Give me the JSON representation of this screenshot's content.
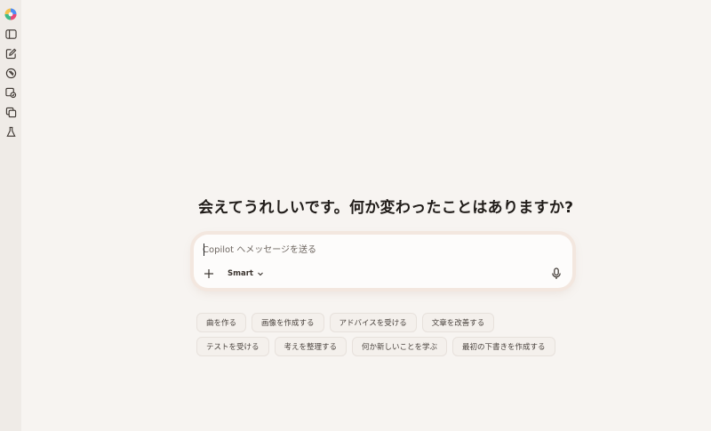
{
  "sidebar": {
    "items": [
      {
        "icon": "copilot-logo-icon"
      },
      {
        "icon": "sidebar-toggle-icon"
      },
      {
        "icon": "new-chat-icon"
      },
      {
        "icon": "discover-icon"
      },
      {
        "icon": "image-gallery-icon"
      },
      {
        "icon": "pages-icon"
      },
      {
        "icon": "labs-flask-icon"
      }
    ]
  },
  "main": {
    "greeting": "会えてうれしいです。何か変わったことはありますか?"
  },
  "composer": {
    "placeholder": "Copilot へメッセージを送る",
    "mode_label": "Smart"
  },
  "suggestions": {
    "chips": [
      "曲を作る",
      "画像を作成する",
      "アドバイスを受ける",
      "文章を改善する",
      "テストを受ける",
      "考えを整理する",
      "何か新しいことを学ぶ",
      "最初の下書きを作成する"
    ]
  },
  "colors": {
    "background": "#f7f4f1",
    "rail": "#efebe7",
    "composer": "#fdfcfb",
    "composer_glow": "#f3e7df",
    "chip": "#f4f0ec"
  }
}
